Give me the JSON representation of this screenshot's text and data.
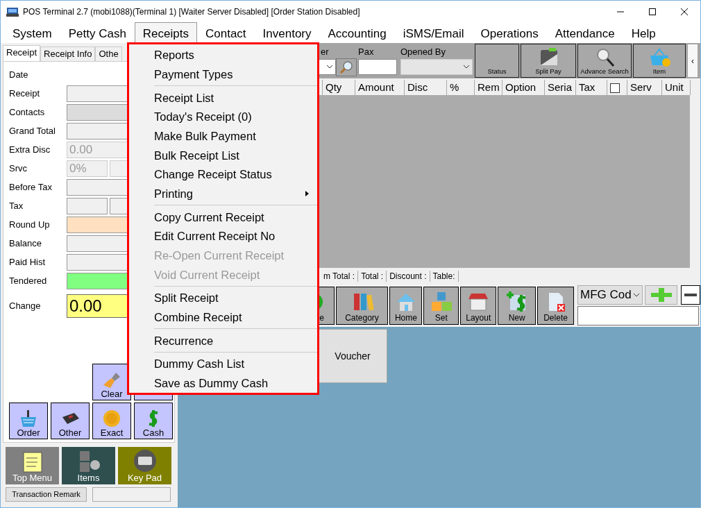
{
  "window": {
    "title": "POS Terminal 2.7 (mobi1088)(Terminal 1) [Waiter Server Disabled] [Order Station Disabled]"
  },
  "menu_bar": [
    {
      "label": "System",
      "selected": false
    },
    {
      "label": "Petty Cash",
      "selected": false
    },
    {
      "label": "Receipts",
      "selected": true
    },
    {
      "label": "Contact",
      "selected": false
    },
    {
      "label": "Inventory",
      "selected": false
    },
    {
      "label": "Accounting",
      "selected": false
    },
    {
      "label": "iSMS/Email",
      "selected": false
    },
    {
      "label": "Operations",
      "selected": false
    },
    {
      "label": "Attendance",
      "selected": false
    },
    {
      "label": "Help",
      "selected": false
    }
  ],
  "receipts_menu": {
    "groups": [
      {
        "items": [
          {
            "label": "Reports",
            "disabled": false,
            "submenu": false
          },
          {
            "label": "Payment Types",
            "disabled": false,
            "submenu": false
          }
        ]
      },
      {
        "items": [
          {
            "label": "Receipt List",
            "disabled": false,
            "submenu": false
          },
          {
            "label": "Today's Receipt (0)",
            "disabled": false,
            "submenu": false
          },
          {
            "label": "Make Bulk Payment",
            "disabled": false,
            "submenu": false
          },
          {
            "label": "Bulk Receipt List",
            "disabled": false,
            "submenu": false
          },
          {
            "label": "Change Receipt Status",
            "disabled": false,
            "submenu": false
          },
          {
            "label": "Printing",
            "disabled": false,
            "submenu": true
          }
        ]
      },
      {
        "items": [
          {
            "label": "Copy Current Receipt",
            "disabled": false,
            "submenu": false
          },
          {
            "label": "Edit Current Receipt No",
            "disabled": false,
            "submenu": false
          },
          {
            "label": "Re-Open Current Receipt",
            "disabled": true,
            "submenu": false
          },
          {
            "label": "Void Current Receipt",
            "disabled": true,
            "submenu": false
          }
        ]
      },
      {
        "items": [
          {
            "label": "Split Receipt",
            "disabled": false,
            "submenu": false
          },
          {
            "label": "Combine Receipt",
            "disabled": false,
            "submenu": false
          }
        ]
      },
      {
        "items": [
          {
            "label": "Recurrence",
            "disabled": false,
            "submenu": false
          }
        ]
      },
      {
        "items": [
          {
            "label": "Dummy Cash List",
            "disabled": false,
            "submenu": false
          },
          {
            "label": "Save as Dummy Cash",
            "disabled": false,
            "submenu": false
          }
        ]
      }
    ]
  },
  "left_panel": {
    "tabs": [
      {
        "label": "Receipt",
        "selected": true
      },
      {
        "label": "Receipt Info",
        "selected": false
      },
      {
        "label": "Othe",
        "selected": false
      }
    ],
    "fields": [
      {
        "label": "Date",
        "kind": "none"
      },
      {
        "label": "Receipt",
        "kind": "single",
        "color": "#f0f0f0",
        "disabled": false
      },
      {
        "label": "Contacts",
        "kind": "single",
        "color": "#dcdcdc",
        "disabled": false
      },
      {
        "label": "Grand Total",
        "kind": "single",
        "color": "#f0f0f0",
        "disabled": false
      },
      {
        "label": "Extra Disc",
        "kind": "single",
        "color": "#f0f0f0",
        "disabled": true,
        "value": "0.00"
      },
      {
        "label": "Srvc",
        "kind": "split",
        "color": "#f0f0f0",
        "disabled": true,
        "value": "0%"
      },
      {
        "label": "Before Tax",
        "kind": "single",
        "color": "#f0f0f0",
        "disabled": false
      },
      {
        "label": "Tax",
        "kind": "split",
        "color": "#f0f0f0",
        "disabled": false
      },
      {
        "label": "Round Up",
        "kind": "single",
        "color": "#ffe0c0",
        "disabled": false
      },
      {
        "label": "Balance",
        "kind": "single",
        "color": "#f0f0f0",
        "disabled": false
      },
      {
        "label": "Paid Hist",
        "kind": "single",
        "color": "#f0f0f0",
        "disabled": false
      },
      {
        "label": "Tendered",
        "kind": "single",
        "color": "#80ff80",
        "disabled": false
      },
      {
        "label": "Change",
        "kind": "big",
        "color": "#ffff80",
        "disabled": false,
        "value": "0.00"
      }
    ],
    "pay_tiles": [
      {
        "label": "Clear"
      },
      {
        "label": "Order"
      },
      {
        "label": "Other"
      },
      {
        "label": "Exact"
      },
      {
        "label": "Cash"
      }
    ],
    "bottom_tiles": [
      {
        "label": "Top Menu",
        "color": "#808080"
      },
      {
        "label": "Items",
        "color": "#2f4f4f"
      },
      {
        "label": "Key Pad",
        "color": "#808000"
      }
    ],
    "remark_button": "Transaction Remark"
  },
  "order_toolbar": {
    "order_label": "er",
    "pax_label": "Pax",
    "opened_by_label": "Opened By",
    "buttons": [
      {
        "label": "Status"
      },
      {
        "label": "Split Pay"
      },
      {
        "label": "Advance Search"
      },
      {
        "label": "Item"
      }
    ],
    "scroll_button": "‹"
  },
  "table": {
    "columns": [
      {
        "kind": "text",
        "label": "Qty"
      },
      {
        "kind": "text",
        "label": "Amount"
      },
      {
        "kind": "text",
        "label": "Disc"
      },
      {
        "kind": "text",
        "label": "%"
      },
      {
        "kind": "text",
        "label": "Rem"
      },
      {
        "kind": "text",
        "label": "Option"
      },
      {
        "kind": "text",
        "label": "Seria"
      },
      {
        "kind": "text",
        "label": "Tax"
      },
      {
        "kind": "checkbox",
        "checked": false
      },
      {
        "kind": "text",
        "label": "Serv"
      },
      {
        "kind": "text",
        "label": "Unit"
      }
    ]
  },
  "totals": [
    "m Total :",
    "Total :",
    "Discount :",
    "Table:"
  ],
  "category_buttons": [
    {
      "label": "e"
    },
    {
      "label": "Category"
    },
    {
      "label": "Home"
    },
    {
      "label": "Set"
    },
    {
      "label": "Layout"
    },
    {
      "label": "New"
    },
    {
      "label": "Delete"
    }
  ],
  "search": {
    "select": "MFG Cod"
  },
  "tiles": [
    {
      "label": "Voucher"
    }
  ]
}
